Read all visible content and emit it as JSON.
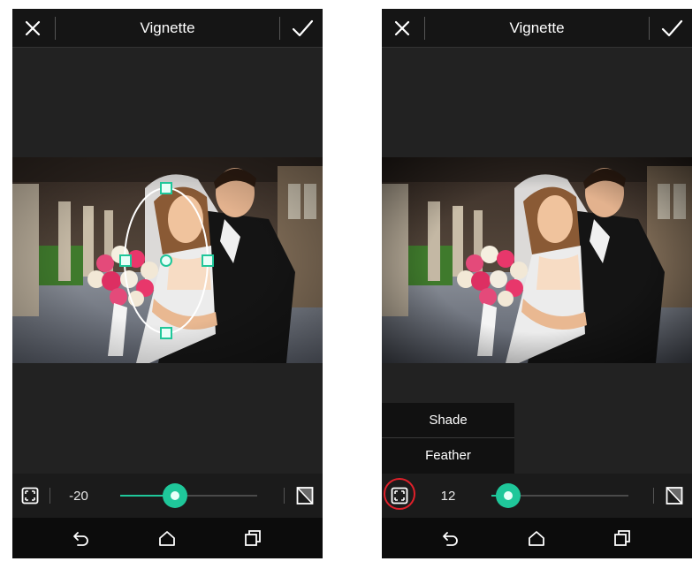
{
  "left": {
    "title": "Vignette",
    "value": "-20",
    "slider_fraction": 0.4
  },
  "right": {
    "title": "Vignette",
    "value": "12",
    "slider_fraction": 0.12,
    "menu": {
      "shade_label": "Shade",
      "feather_label": "Feather"
    }
  },
  "icons": {
    "close": "close-icon",
    "confirm": "check-icon",
    "shape": "vignette-shape-icon",
    "invert": "invert-icon",
    "back": "back-icon",
    "home": "home-icon",
    "recent": "recent-apps-icon"
  },
  "colors": {
    "accent": "#1fc79a",
    "highlight": "#e0202a",
    "background": "#222222"
  }
}
